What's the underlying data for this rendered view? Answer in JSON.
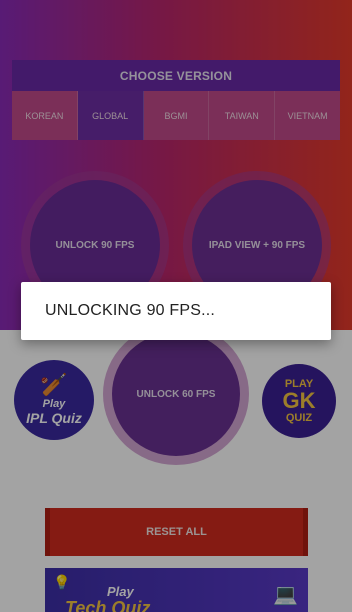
{
  "version_panel": {
    "title": "CHOOSE VERSION",
    "tabs": [
      {
        "label": "KOREAN",
        "active": false
      },
      {
        "label": "GLOBAL",
        "active": true
      },
      {
        "label": "BGMI",
        "active": false
      },
      {
        "label": "TAIWAN",
        "active": false
      },
      {
        "label": "VIETNAM",
        "active": false
      }
    ]
  },
  "buttons": {
    "unlock90": "UNLOCK 90 FPS",
    "ipad90": "IPAD VIEW + 90 FPS",
    "unlock60": "UNLOCK 60 FPS",
    "reset": "RESET ALL"
  },
  "promos": {
    "ipl": {
      "line1": "Play",
      "line2": "IPL Quiz"
    },
    "gk": {
      "play": "PLAY",
      "big": "GK",
      "quiz": "QUIZ"
    },
    "tech": {
      "play": "Play",
      "title": "Tech Quiz"
    }
  },
  "dialog": {
    "message": "UNLOCKING 90 FPS..."
  },
  "colors": {
    "gradient_start": "#8a2bb8",
    "gradient_end": "#e53a2a",
    "reset_red": "#d12b1e",
    "overlay": "rgba(0,0,0,0.36)"
  }
}
